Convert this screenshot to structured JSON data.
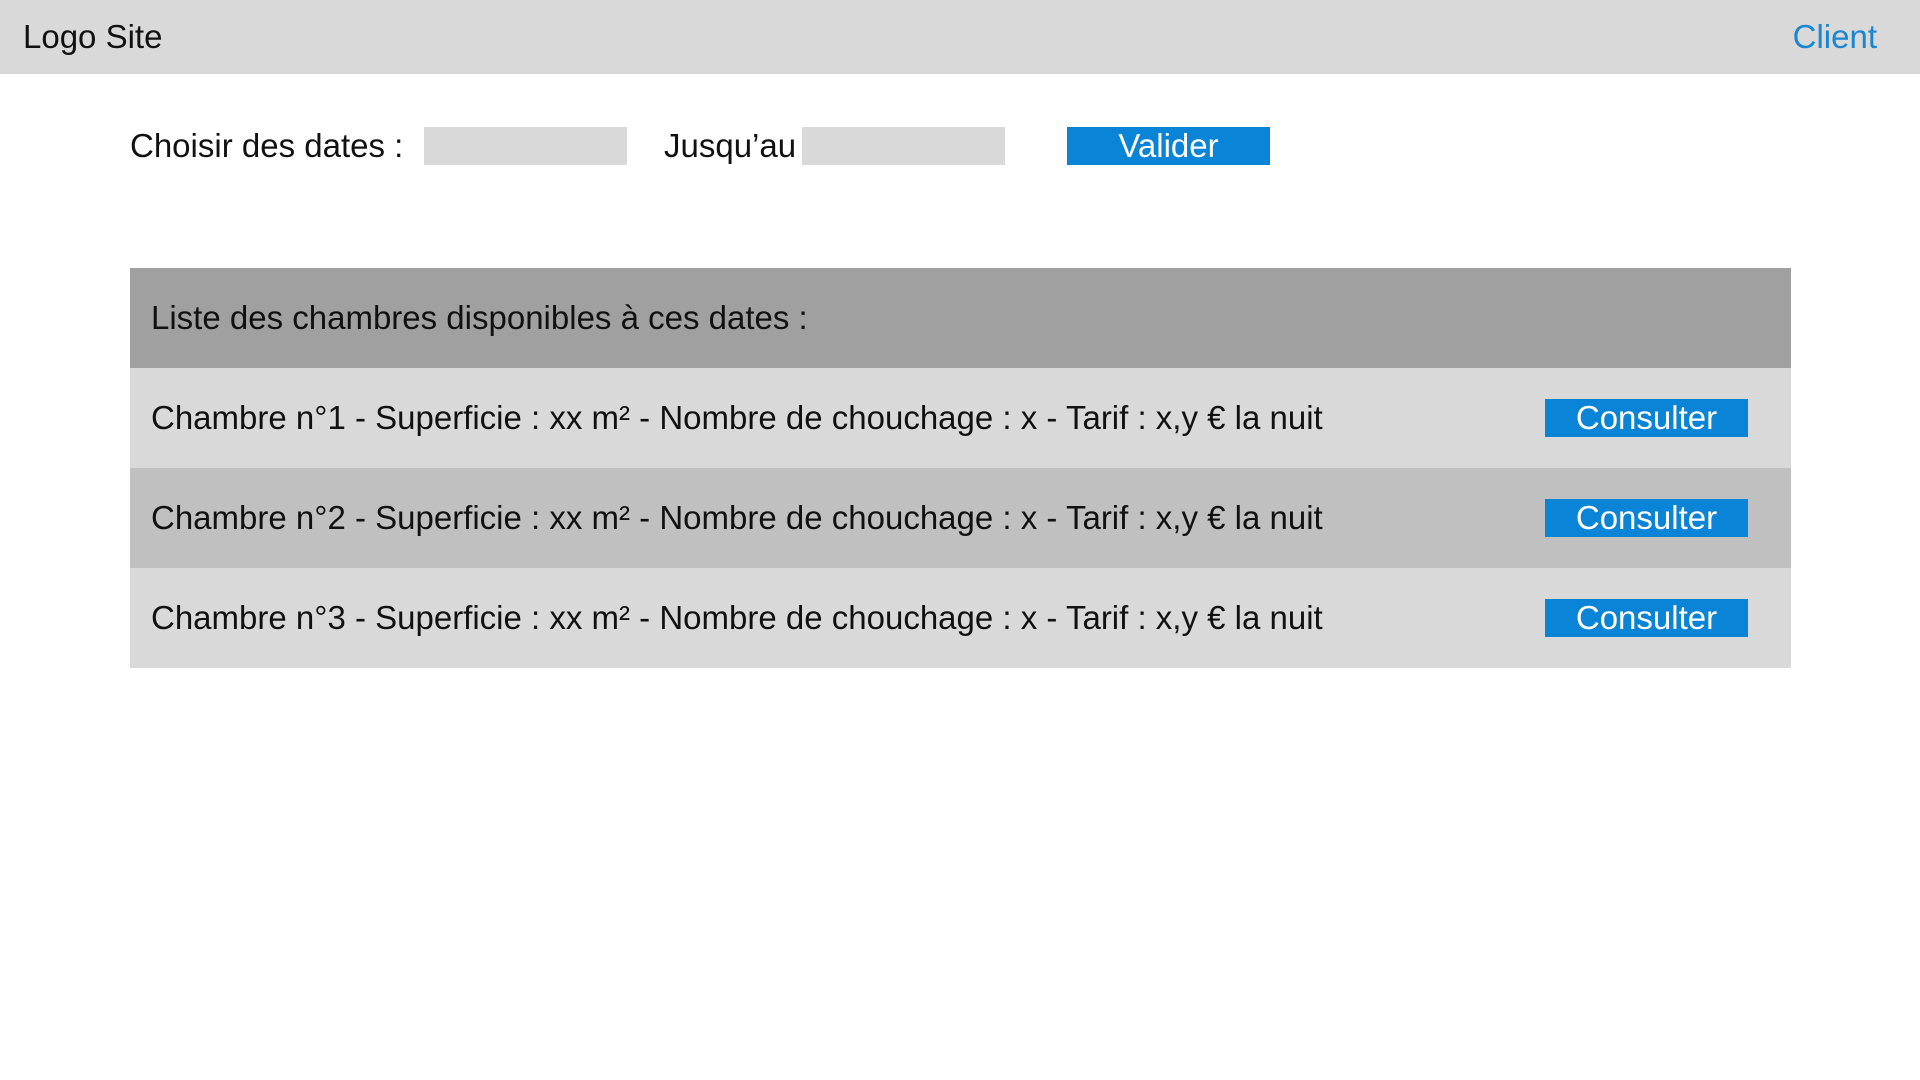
{
  "header": {
    "logo_text": "Logo Site",
    "client_link": "Client"
  },
  "date_selector": {
    "from_label": "Choisir des dates :",
    "from_value": "",
    "to_label": "Jusqu’au",
    "to_value": "",
    "validate_label": "Valider"
  },
  "rooms": {
    "header": "Liste des chambres disponibles à ces dates :",
    "items": [
      {
        "description": "Chambre n°1 - Superficie : xx m² - Nombre de chouchage : x - Tarif : x,y € la nuit",
        "action_label": "Consulter"
      },
      {
        "description": "Chambre n°2 - Superficie : xx m² - Nombre de chouchage : x - Tarif : x,y € la nuit",
        "action_label": "Consulter"
      },
      {
        "description": "Chambre n°3 - Superficie : xx m² - Nombre de chouchage : x - Tarif : x,y € la nuit",
        "action_label": "Consulter"
      }
    ]
  },
  "colors": {
    "accent": "#0a84d6",
    "link": "#1a86d0",
    "topbar": "#d9d9d9",
    "table_header": "#a0a0a0",
    "row_light": "#d9d9d9",
    "row_dark": "#c0c0c0"
  }
}
